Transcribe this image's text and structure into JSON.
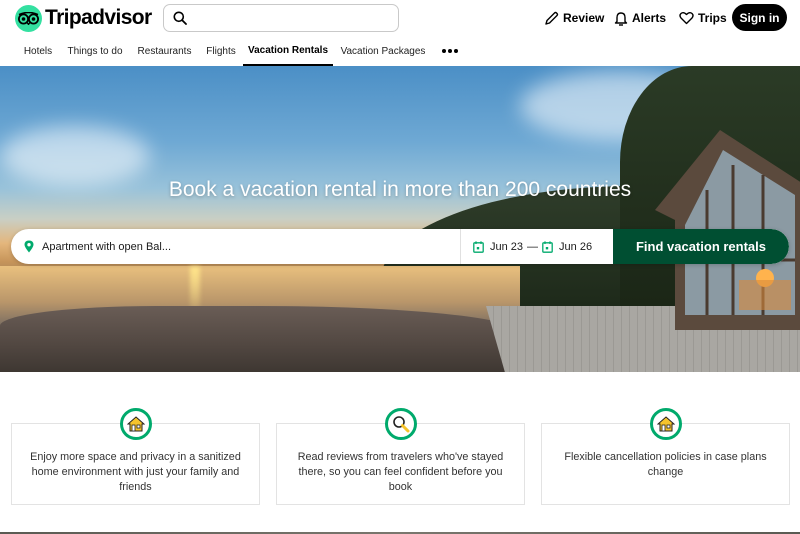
{
  "brand": {
    "name": "Tripadvisor",
    "logo_color": "#34e0a1",
    "primary_green": "#004f32",
    "accent_green": "#00aa6c"
  },
  "header": {
    "search": {
      "value": "",
      "placeholder": ""
    },
    "links": [
      {
        "label": "Review",
        "icon": "pencil-icon"
      },
      {
        "label": "Alerts",
        "icon": "bell-icon"
      },
      {
        "label": "Trips",
        "icon": "heart-icon"
      }
    ],
    "sign_in_label": "Sign in"
  },
  "nav": {
    "items": [
      {
        "label": "Hotels",
        "active": false
      },
      {
        "label": "Things to do",
        "active": false
      },
      {
        "label": "Restaurants",
        "active": false
      },
      {
        "label": "Flights",
        "active": false
      },
      {
        "label": "Vacation Rentals",
        "active": true
      },
      {
        "label": "Vacation Packages",
        "active": false
      }
    ],
    "more_icon": "more-dots-icon"
  },
  "hero": {
    "title": "Book a vacation rental in more than 200 countries",
    "search": {
      "location_value": "Apartment with open Bal...",
      "location_icon": "map-pin-icon",
      "check_in": "Jun 23",
      "separator": "—",
      "check_out": "Jun 26",
      "date_icon": "calendar-icon",
      "button_label": "Find vacation rentals"
    }
  },
  "features": [
    {
      "icon": "house-icon",
      "text": "Enjoy more space and privacy in a sanitized home environment with just your family and friends"
    },
    {
      "icon": "magnifier-icon",
      "text": "Read reviews from travelers who've stayed there, so you can feel confident before you book"
    },
    {
      "icon": "house-icon",
      "text": "Flexible cancellation policies in case plans change"
    }
  ]
}
